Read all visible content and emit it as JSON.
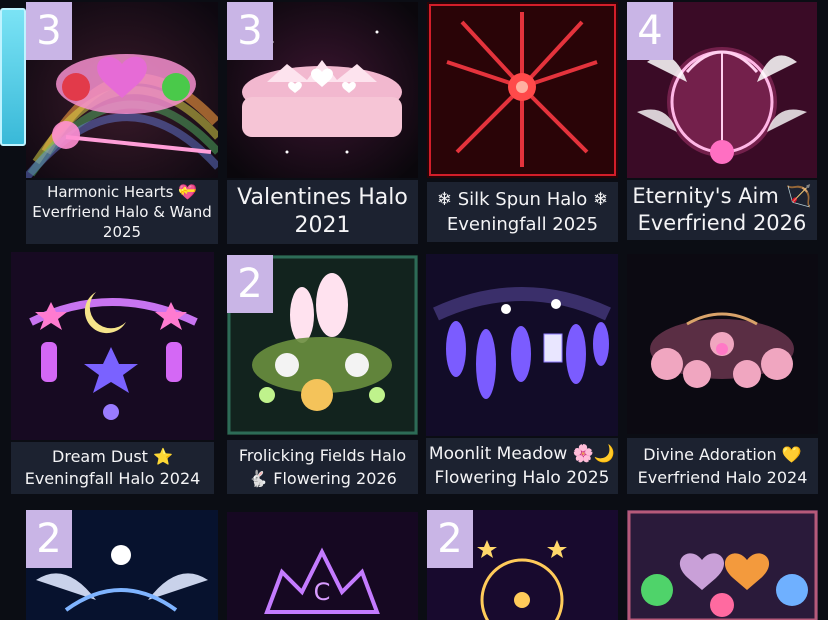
{
  "items": [
    {
      "id": "harmonic-hearts",
      "badge": "3",
      "line1": "Harmonic Hearts 💝",
      "line2": "Everfriend Halo & Wand",
      "line3": "2025"
    },
    {
      "id": "valentines-halo",
      "badge": "3",
      "line1": "Valentines Halo",
      "line2": "2021"
    },
    {
      "id": "silk-spun-halo",
      "badge": "",
      "line1": "❄ Silk Spun Halo ❄",
      "line2": "Eveningfall 2025"
    },
    {
      "id": "eternitys-aim",
      "badge": "4",
      "line1": "Eternity's Aim 🏹",
      "line2": "Everfriend 2026"
    },
    {
      "id": "dream-dust",
      "badge": "",
      "line1": "Dream Dust ⭐",
      "line2": "Eveningfall Halo 2024"
    },
    {
      "id": "frolicking-fields",
      "badge": "2",
      "line1": "Frolicking Fields Halo",
      "line2": "🐇 Flowering 2026"
    },
    {
      "id": "moonlit-meadow",
      "badge": "",
      "line1": "Moonlit Meadow 🌸🌙",
      "line2": "Flowering Halo 2025"
    },
    {
      "id": "divine-adoration",
      "badge": "",
      "line1": "Divine Adoration 💛",
      "line2": "Everfriend Halo 2024"
    },
    {
      "id": "row3-item-1",
      "badge": "2"
    },
    {
      "id": "row3-item-2",
      "badge": ""
    },
    {
      "id": "row3-item-3",
      "badge": "2"
    },
    {
      "id": "row3-item-4",
      "badge": ""
    }
  ],
  "colors": {
    "background": "#0b0d14",
    "caption_bg": "#1c2230",
    "badge_bg": "#c9b5e6",
    "side_tab": "#5cd0e8"
  }
}
